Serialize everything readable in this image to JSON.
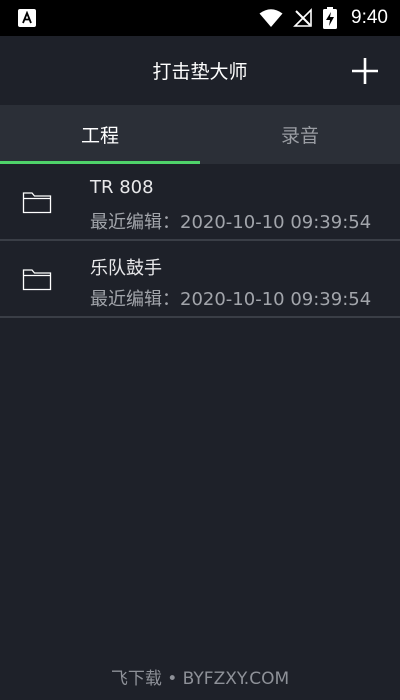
{
  "status_bar": {
    "time": "9:40",
    "icons": [
      "app-notification-icon",
      "wifi-icon",
      "no-signal-icon",
      "battery-charging-icon"
    ]
  },
  "app_bar": {
    "title": "打击垫大师",
    "add_icon": "plus-icon"
  },
  "tabs": [
    {
      "label": "工程",
      "active": true
    },
    {
      "label": "录音",
      "active": false
    }
  ],
  "projects": [
    {
      "name": "TR 808",
      "last_edited": "最近编辑：2020-10-10 09:39:54",
      "icon": "folder-icon"
    },
    {
      "name": "乐队鼓手",
      "last_edited": "最近编辑：2020-10-10 09:39:54",
      "icon": "folder-icon"
    }
  ],
  "watermark": "飞下载 • BYFZXY.COM",
  "colors": {
    "background": "#1e2129",
    "tab_bar": "#2b2f37",
    "accent": "#4fd36a",
    "divider": "#3a3e46"
  }
}
